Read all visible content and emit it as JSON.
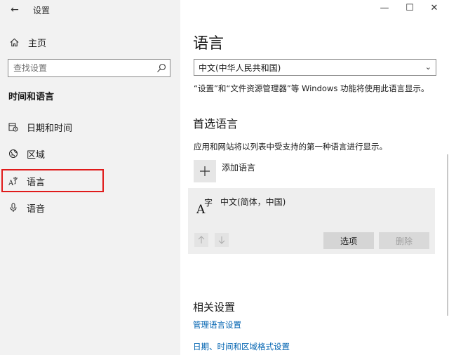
{
  "window": {
    "title": "设置",
    "back_glyph": "←",
    "minimize_glyph": "—",
    "maximize_glyph": "☐",
    "close_glyph": "✕"
  },
  "sidebar": {
    "home_label": "主页",
    "search_placeholder": "查找设置",
    "section_title": "时间和语言",
    "items": [
      {
        "label": "日期和时间",
        "icon": "calendar-clock-icon"
      },
      {
        "label": "区域",
        "icon": "globe-icon"
      },
      {
        "label": "语言",
        "icon": "language-icon"
      },
      {
        "label": "语音",
        "icon": "microphone-icon"
      }
    ]
  },
  "main": {
    "title": "语言",
    "display_language": "中文(中华人民共和国)",
    "display_language_note": "“设置”和“文件资源管理器”等 Windows 功能将使用此语言显示。",
    "preferred_title": "首选语言",
    "preferred_note": "应用和网站将以列表中受支持的第一种语言进行显示。",
    "add_language_label": "添加语言",
    "languages": [
      {
        "name": "中文(简体，中国)"
      }
    ],
    "options_label": "选项",
    "remove_label": "删除",
    "related_title": "相关设置",
    "related_links": [
      "管理语言设置",
      "日期、时间和区域格式设置"
    ]
  },
  "colors": {
    "accent_link": "#0063b1",
    "highlight_box": "#e01b1b",
    "sidebar_bg": "#f2f2f2"
  }
}
